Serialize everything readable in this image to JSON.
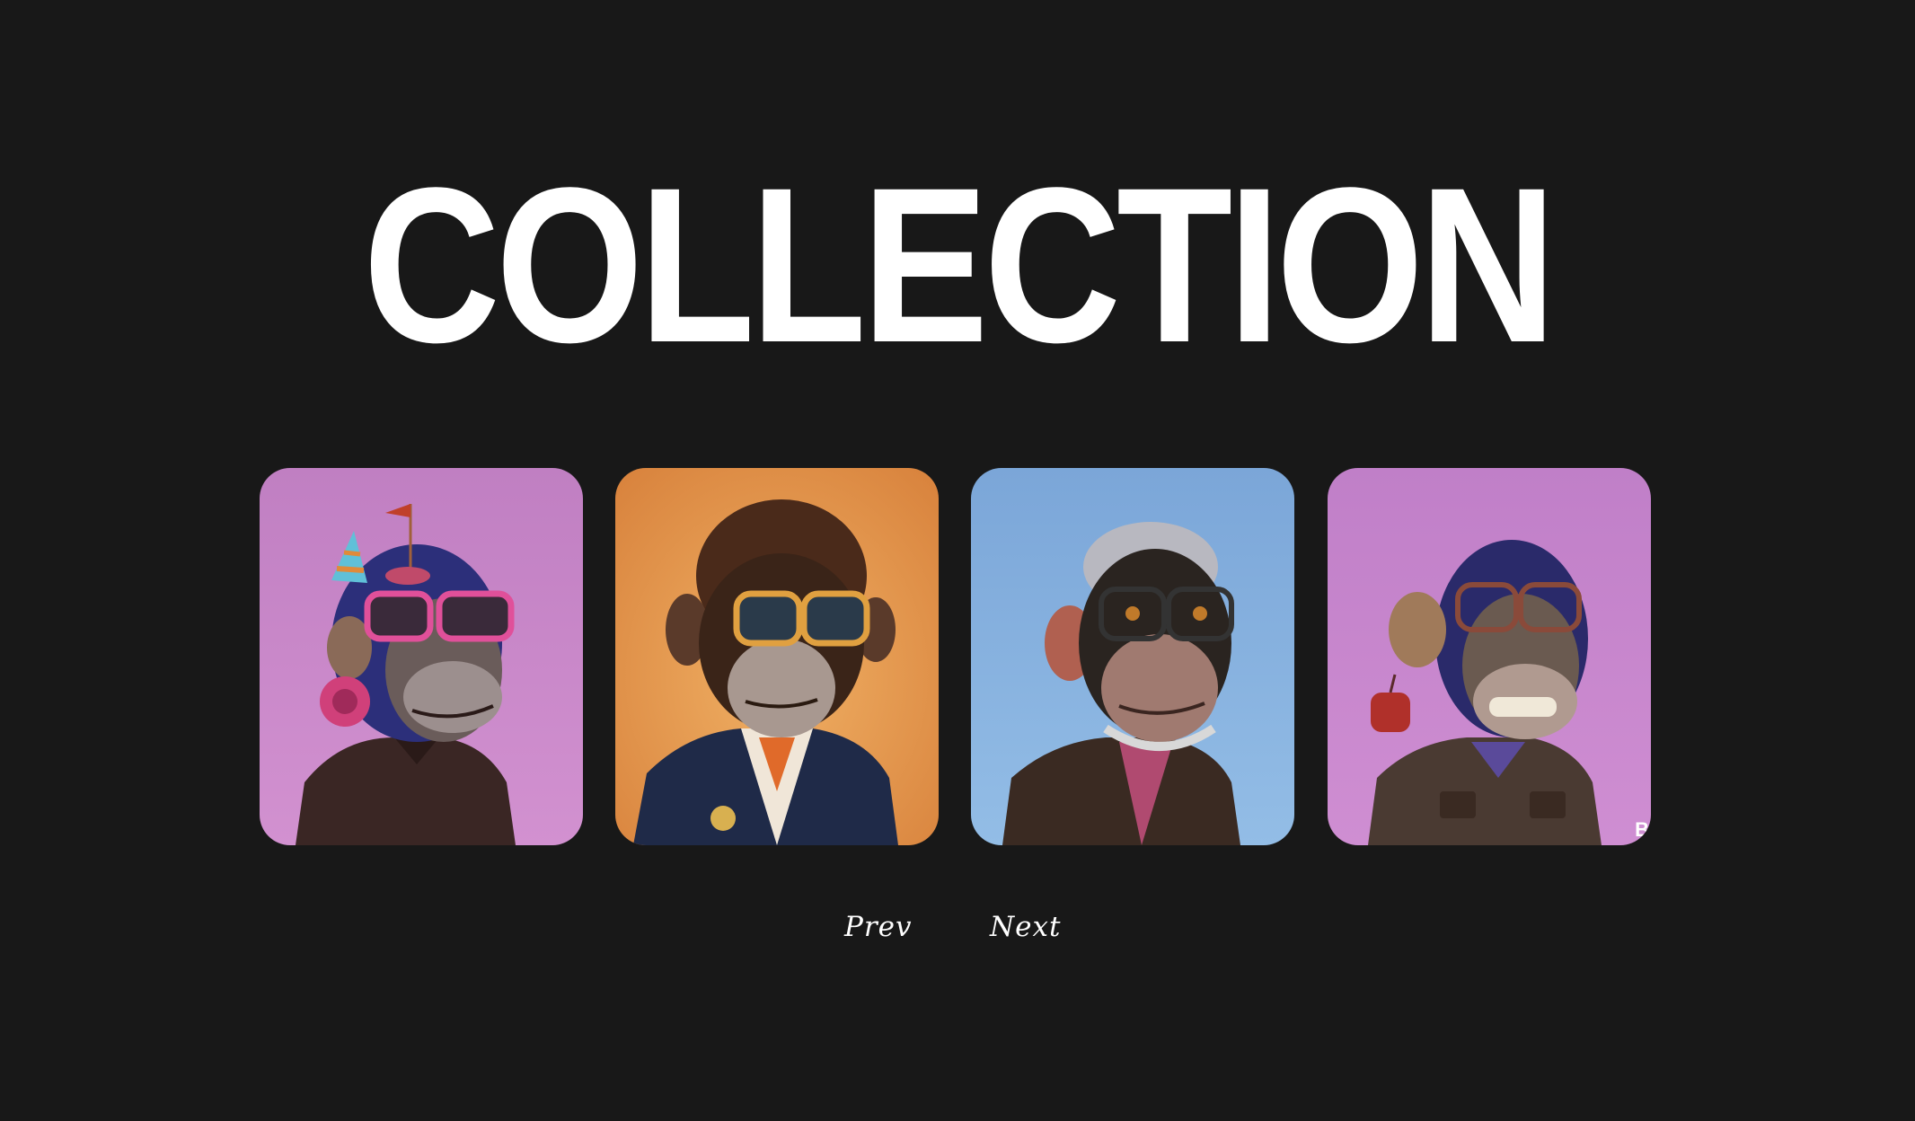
{
  "header": {
    "title": "COLLECTION"
  },
  "gallery": {
    "cards": [
      {
        "bg_top": "#c07fc2",
        "bg_bottom": "#d291d0",
        "accessory": "party-hat-headphones",
        "glasses": "#e0509a"
      },
      {
        "bg_top": "#d9843e",
        "bg_bottom": "#eaa55c",
        "accessory": "afro-sunglasses",
        "glasses": "#e0a040"
      },
      {
        "bg_top": "#7ba6d8",
        "bg_bottom": "#93bde6",
        "accessory": "grey-hair-glasses",
        "glasses": "#333333"
      },
      {
        "bg_top": "#c07fc8",
        "bg_bottom": "#cf8ed2",
        "accessory": "mug-glasses",
        "glasses": "#8a4a3a",
        "badge": "B"
      }
    ]
  },
  "pager": {
    "prev_label": "Prev",
    "next_label": "Next"
  },
  "colors": {
    "background": "#181818",
    "text": "#ffffff"
  }
}
